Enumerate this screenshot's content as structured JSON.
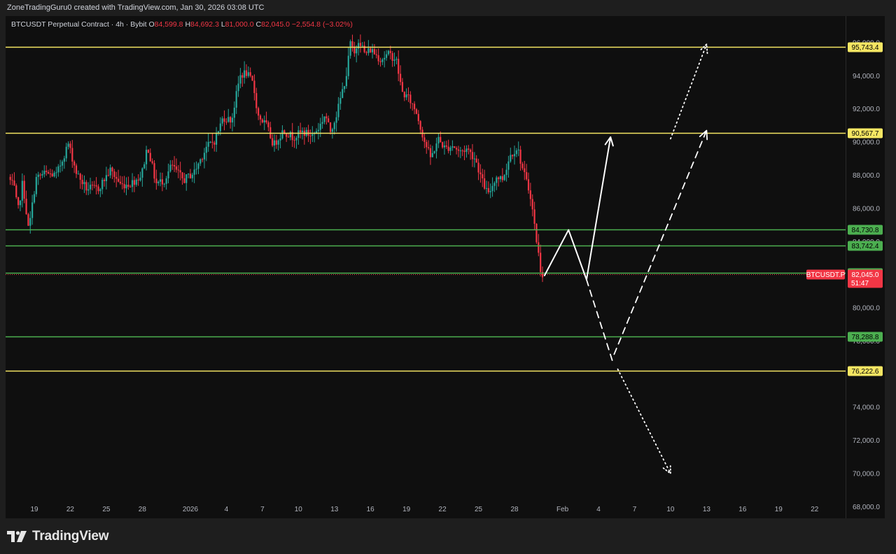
{
  "header": {
    "credit": "ZoneTradingGuru0 created with TradingView.com, Jan 30, 2026 03:08 UTC"
  },
  "legend": {
    "symbol": "BTCUSDT Perpetual Contract · 4h · Bybit",
    "o_label": "O",
    "o_value": "84,599.8",
    "h_label": "H",
    "h_value": "84,692.3",
    "l_label": "L",
    "l_value": "81,000.0",
    "c_label": "C",
    "c_value": "82,045.0",
    "change": "−2,554.8 (−3.02%)"
  },
  "footer": {
    "brand": "TradingView"
  },
  "colors": {
    "background": "#0f0f0f",
    "up": "#26a69a",
    "down": "#f23645",
    "resistance": "#f5e663",
    "support": "#4caf50",
    "projection": "#ffffff"
  },
  "chart_data": {
    "type": "candlestick",
    "timeframe": "4h",
    "price_range": [
      67300,
      97600
    ],
    "y_ticks": [
      {
        "v": 68000,
        "label": "68,000.0"
      },
      {
        "v": 70000,
        "label": "70,000.0"
      },
      {
        "v": 72000,
        "label": "72,000.0"
      },
      {
        "v": 74000,
        "label": "74,000.0"
      },
      {
        "v": 78000,
        "label": "78,000.0"
      },
      {
        "v": 80000,
        "label": "80,000.0"
      },
      {
        "v": 84000,
        "label": "84,000.0"
      },
      {
        "v": 86000,
        "label": "86,000.0"
      },
      {
        "v": 88000,
        "label": "88,000.0"
      },
      {
        "v": 90000,
        "label": "90,000.0"
      },
      {
        "v": 92000,
        "label": "92,000.0"
      },
      {
        "v": 94000,
        "label": "94,000.0"
      },
      {
        "v": 96000,
        "label": "96,000.0"
      }
    ],
    "x_ticks": [
      {
        "day": 0,
        "label": "19"
      },
      {
        "day": 3,
        "label": "22"
      },
      {
        "day": 6,
        "label": "25"
      },
      {
        "day": 9,
        "label": "28"
      },
      {
        "day": 13,
        "label": "2026"
      },
      {
        "day": 16,
        "label": "4"
      },
      {
        "day": 19,
        "label": "7"
      },
      {
        "day": 22,
        "label": "10"
      },
      {
        "day": 25,
        "label": "13"
      },
      {
        "day": 28,
        "label": "16"
      },
      {
        "day": 31,
        "label": "19"
      },
      {
        "day": 34,
        "label": "22"
      },
      {
        "day": 37,
        "label": "25"
      },
      {
        "day": 40,
        "label": "28"
      },
      {
        "day": 44,
        "label": "Feb"
      },
      {
        "day": 47,
        "label": "4"
      },
      {
        "day": 50,
        "label": "7"
      },
      {
        "day": 53,
        "label": "10"
      },
      {
        "day": 56,
        "label": "13"
      },
      {
        "day": 59,
        "label": "16"
      },
      {
        "day": 62,
        "label": "19"
      },
      {
        "day": 65,
        "label": "22"
      }
    ],
    "price_path": [
      [
        -2.0,
        87900
      ],
      [
        -1.5,
        87200
      ],
      [
        -1.2,
        85800
      ],
      [
        -0.8,
        87600
      ],
      [
        -0.3,
        84600
      ],
      [
        0.3,
        87800
      ],
      [
        1.0,
        88100
      ],
      [
        2.0,
        88000
      ],
      [
        3.0,
        89900
      ],
      [
        3.7,
        88100
      ],
      [
        4.5,
        87200
      ],
      [
        5.5,
        87200
      ],
      [
        6.5,
        88300
      ],
      [
        7.4,
        87400
      ],
      [
        8.2,
        87500
      ],
      [
        9.1,
        88000
      ],
      [
        9.6,
        89800
      ],
      [
        10.3,
        87500
      ],
      [
        11.0,
        87700
      ],
      [
        11.6,
        88600
      ],
      [
        12.6,
        87700
      ],
      [
        13.5,
        88200
      ],
      [
        14.5,
        89700
      ],
      [
        15.2,
        90100
      ],
      [
        15.9,
        91500
      ],
      [
        16.6,
        91300
      ],
      [
        17.3,
        94000
      ],
      [
        17.8,
        94200
      ],
      [
        18.4,
        93500
      ],
      [
        18.8,
        91600
      ],
      [
        19.5,
        91000
      ],
      [
        20.1,
        89800
      ],
      [
        20.9,
        90700
      ],
      [
        21.7,
        90300
      ],
      [
        22.5,
        90600
      ],
      [
        23.3,
        90400
      ],
      [
        23.9,
        90900
      ],
      [
        24.4,
        91700
      ],
      [
        24.8,
        90600
      ],
      [
        25.4,
        91800
      ],
      [
        26.2,
        94200
      ],
      [
        26.5,
        96000
      ],
      [
        26.8,
        95200
      ],
      [
        27.2,
        96300
      ],
      [
        27.7,
        95300
      ],
      [
        28.2,
        95600
      ],
      [
        29.0,
        95000
      ],
      [
        29.7,
        95300
      ],
      [
        30.3,
        95000
      ],
      [
        30.8,
        93000
      ],
      [
        31.4,
        92600
      ],
      [
        32.0,
        91800
      ],
      [
        32.6,
        90200
      ],
      [
        33.2,
        89000
      ],
      [
        33.8,
        90200
      ],
      [
        34.4,
        89600
      ],
      [
        35.0,
        89800
      ],
      [
        35.6,
        89400
      ],
      [
        36.2,
        89600
      ],
      [
        36.9,
        89000
      ],
      [
        37.5,
        87600
      ],
      [
        38.0,
        86800
      ],
      [
        38.6,
        87900
      ],
      [
        39.2,
        87800
      ],
      [
        39.8,
        89200
      ],
      [
        40.4,
        89700
      ],
      [
        40.9,
        88200
      ],
      [
        41.5,
        86800
      ],
      [
        41.9,
        84600
      ],
      [
        42.4,
        82000
      ]
    ],
    "horizontal_levels": [
      {
        "value": 95743.4,
        "label": "95,743.4",
        "role": "resistance"
      },
      {
        "value": 90567.7,
        "label": "90,567.7",
        "role": "resistance"
      },
      {
        "value": 84730.8,
        "label": "84,730.8",
        "role": "support"
      },
      {
        "value": 83742.4,
        "label": "83,742.4",
        "role": "support"
      },
      {
        "value": 82098.0,
        "label": "82,098.0",
        "role": "support"
      },
      {
        "value": 78288.8,
        "label": "78,288.8",
        "role": "support"
      },
      {
        "value": 76222.6,
        "label": "76,222.6",
        "role": "resistance"
      }
    ],
    "last_price": {
      "symbol": "BTCUSDT.P",
      "value": "82,045.0",
      "countdown": "51:47",
      "v": 82045.0
    },
    "projections": [
      {
        "style": "solid",
        "points": [
          [
            42.5,
            81950
          ],
          [
            44.5,
            84700
          ],
          [
            46.0,
            81700
          ],
          [
            48.0,
            90300
          ]
        ],
        "arrow": true
      },
      {
        "style": "dashed",
        "points": [
          [
            46.0,
            81700
          ],
          [
            48.2,
            76700
          ]
        ]
      },
      {
        "style": "dashed",
        "points": [
          [
            48.3,
            77200
          ],
          [
            56.0,
            90700
          ]
        ],
        "arrow": true
      },
      {
        "style": "dotted",
        "points": [
          [
            53.0,
            90200
          ],
          [
            56.0,
            95900
          ]
        ],
        "arrow": true
      },
      {
        "style": "dotted",
        "points": [
          [
            48.6,
            76300
          ],
          [
            53.0,
            70000
          ]
        ],
        "arrow": true
      }
    ]
  }
}
